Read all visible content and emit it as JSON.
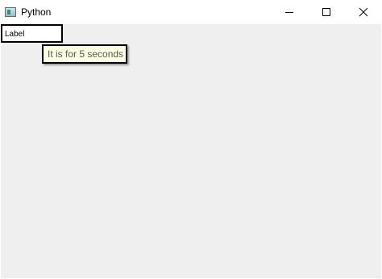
{
  "window": {
    "title": "Python",
    "icon": "python-tk-app-icon",
    "controls": {
      "minimize": "minimize-icon",
      "maximize": "maximize-icon",
      "close": "close-icon"
    }
  },
  "content": {
    "label_text": "Label",
    "tooltip_text": "It is for 5 seconds"
  },
  "colors": {
    "client_background": "#efefef",
    "tooltip_background": "#ffffe1",
    "tooltip_text": "#575757"
  }
}
